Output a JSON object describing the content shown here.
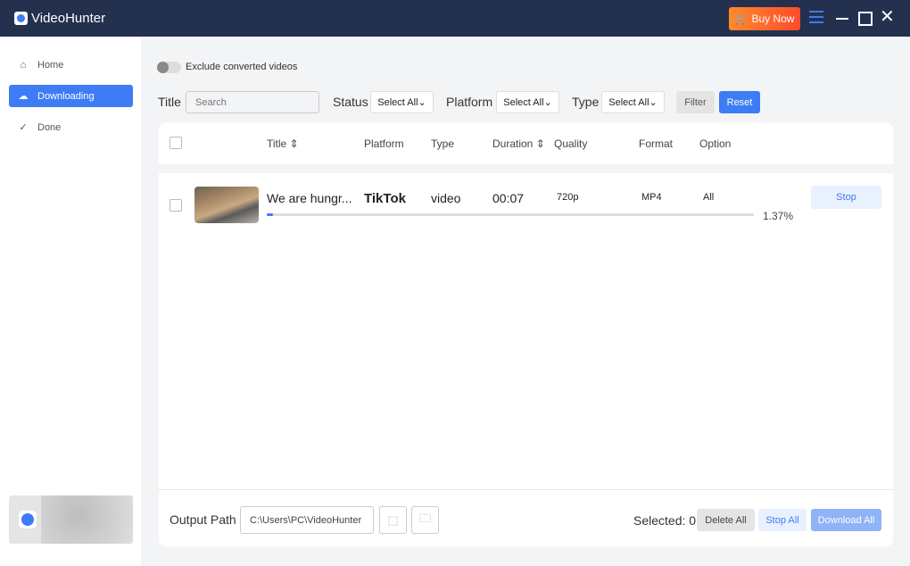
{
  "app": {
    "title": "VideoHunter",
    "buy_label": "Buy Now"
  },
  "sidebar": {
    "items": [
      {
        "label": "Home",
        "icon": "home-icon"
      },
      {
        "label": "Downloading",
        "icon": "cloud-download-icon",
        "active": true
      },
      {
        "label": "Done",
        "icon": "check-circle-icon"
      }
    ]
  },
  "filters": {
    "exclude_label": "Exclude converted videos",
    "exclude_on": false,
    "title_label": "Title",
    "search_placeholder": "Search",
    "status_label": "Status",
    "status_value": "Select All",
    "platform_label": "Platform",
    "platform_value": "Select All",
    "type_label": "Type",
    "type_value": "Select All",
    "filter_label": "Filter",
    "reset_label": "Reset"
  },
  "table": {
    "columns": [
      "Title",
      "Platform",
      "Type",
      "Duration",
      "Quality",
      "Format",
      "Option"
    ],
    "rows": [
      {
        "title": "We are hungr...",
        "platform": "TikTok",
        "type": "video",
        "duration": "00:07",
        "quality": "720p",
        "format": "MP4",
        "option": "All",
        "progress": 1.37,
        "progress_label": "1.37%",
        "action": "Stop"
      }
    ]
  },
  "footer": {
    "output_label": "Output Path",
    "output_path": "C:\\Users\\PC\\VideoHunter",
    "selected_label": "Selected: 0",
    "delete_all": "Delete All",
    "stop_all": "Stop All",
    "download_all": "Download All"
  },
  "colors": {
    "accent": "#3d7cf5",
    "titlebar": "#23314f",
    "buy": "#ff6a2b"
  }
}
